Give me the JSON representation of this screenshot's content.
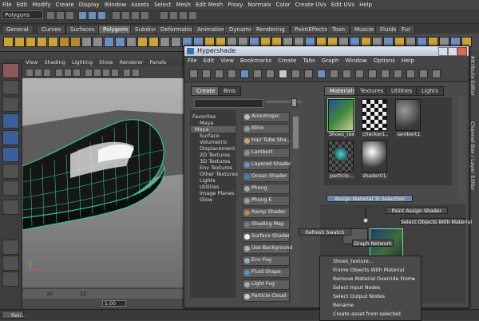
{
  "menubar": [
    "File",
    "Edit",
    "Modify",
    "Create",
    "Display",
    "Window",
    "Assets",
    "Select",
    "Mesh",
    "Edit Mesh",
    "Proxy",
    "Normals",
    "Color",
    "Create UVs",
    "Edit UVs",
    "Help"
  ],
  "status_line": {
    "mode": "Polygons"
  },
  "shelf_tabs": [
    "General",
    "Curves",
    "Surfaces",
    "Polygons",
    "Subdivs",
    "Deformation",
    "Animation",
    "Dynamics",
    "Rendering",
    "PaintEffects",
    "Toon",
    "Muscle",
    "Fluids",
    "Fur"
  ],
  "shelf_active": "Polygons",
  "viewport_menu": [
    "View",
    "Shading",
    "Lighting",
    "Show",
    "Renderer",
    "Panels"
  ],
  "timeline": {
    "ticks": [
      "10",
      "12"
    ],
    "current_value": "1.00"
  },
  "taskbar": {
    "item": "Ren..."
  },
  "side_strip": {
    "attribute_editor": "Attribute Editor",
    "channel_box": "Channel Box / Layer Editor"
  },
  "hypershade": {
    "title": "Hypershade",
    "menu": [
      "File",
      "Edit",
      "View",
      "Bookmarks",
      "Create",
      "Tabs",
      "Graph",
      "Window",
      "Options",
      "Help"
    ],
    "left_tabs": [
      "Create",
      "Bins"
    ],
    "tree": [
      {
        "label": "Favorites",
        "level": 0
      },
      {
        "label": "Maya",
        "level": 1
      },
      {
        "label": "Maya",
        "level": 0,
        "highlight": true
      },
      {
        "label": "Surface",
        "level": 1
      },
      {
        "label": "Volumetric",
        "level": 1
      },
      {
        "label": "Displacement",
        "level": 1
      },
      {
        "label": "2D Textures",
        "level": 1
      },
      {
        "label": "3D Textures",
        "level": 1
      },
      {
        "label": "Env Textures",
        "level": 1
      },
      {
        "label": "Other Textures",
        "level": 1
      },
      {
        "label": "Lights",
        "level": 1
      },
      {
        "label": "Utilities",
        "level": 1
      },
      {
        "label": "Image Planes",
        "level": 1
      },
      {
        "label": "Glow",
        "level": 1
      }
    ],
    "nodes": [
      {
        "label": "Anisotropic",
        "color": "#b8b8b8"
      },
      {
        "label": "Blinn",
        "color": "#9a9a9a"
      },
      {
        "label": "Hair Tube Sha...",
        "color": "#c2a36a"
      },
      {
        "label": "Lambert",
        "color": "#8f8f8f"
      },
      {
        "label": "Layered Shader",
        "color": "#6e8fbf"
      },
      {
        "label": "Ocean Shader",
        "color": "#4b7bb0"
      },
      {
        "label": "Phong",
        "color": "#a7a7a7"
      },
      {
        "label": "Phong E",
        "color": "#9f9f9f"
      },
      {
        "label": "Ramp Shader",
        "color": "#b48a4f"
      },
      {
        "label": "Shading Map",
        "color": "#7b7b7b"
      },
      {
        "label": "Surface Shader",
        "color": "#efefef"
      },
      {
        "label": "Use Background",
        "color": "#b3b3b3"
      },
      {
        "label": "Env Fog",
        "color": "#9aa7b4"
      },
      {
        "label": "Fluid Shape",
        "color": "#5f8fb0"
      },
      {
        "label": "Light Fog",
        "color": "#a9a9a9"
      },
      {
        "label": "Particle Cloud",
        "color": "#c9c9c9"
      }
    ],
    "right_tabs": [
      "Materials",
      "Textures",
      "Utilities",
      "Lights"
    ],
    "materials": [
      {
        "label": "Shoes_tex...",
        "swatch": "texture",
        "selected": true
      },
      {
        "label": "checker1...",
        "swatch": "checker",
        "selected": false
      },
      {
        "label": "lambert1",
        "swatch": "lambert",
        "selected": false
      },
      {
        "label": "particle...",
        "swatch": "particle",
        "selected": false
      },
      {
        "label": "shader01...",
        "swatch": "shader",
        "selected": false
      }
    ],
    "popups": {
      "assign_material": "Assign Material To Selection",
      "paint_assign": "Paint Assign Shader",
      "select_objects": "Select Objects With Material",
      "refresh_swatch": "Refresh Swatch",
      "graph_network": "Graph Network"
    }
  },
  "context_menu": {
    "items": [
      "Shoes_texture...",
      "Frame Objects With Material",
      "Remove Material Override From",
      "Select Input Nodes",
      "Select Output Nodes",
      "Rename",
      "Create asset from selected"
    ]
  },
  "colors": {
    "maya_bg": "#444444",
    "viewport_accent": "#2fd5a0",
    "selection_green": "#7dd77d",
    "highlight_blue": "#6d86a8"
  }
}
